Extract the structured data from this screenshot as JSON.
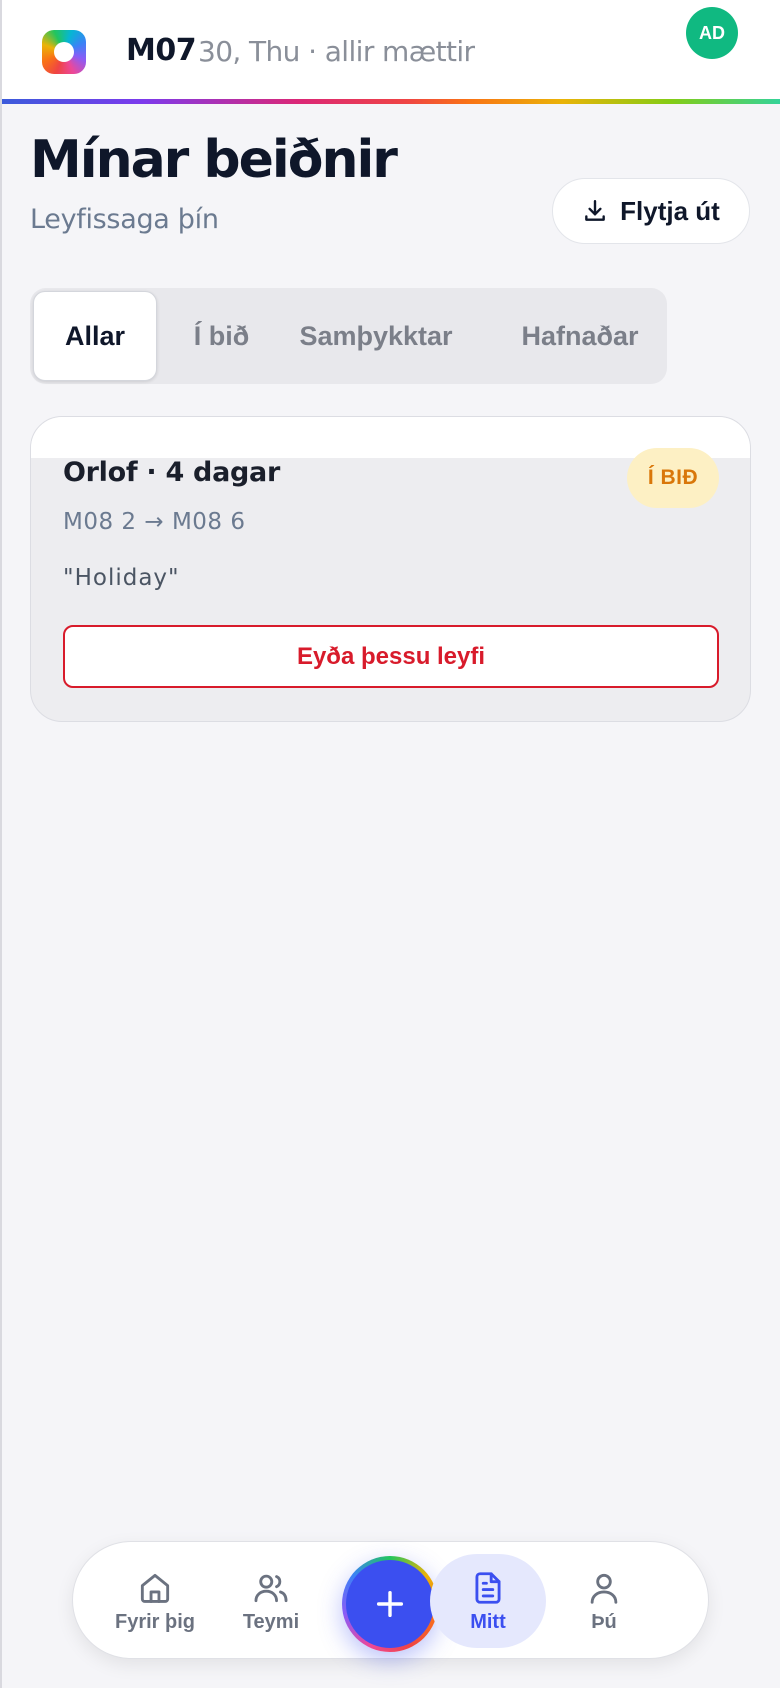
{
  "header": {
    "month": "M07",
    "info": "30, Thu · allir mættir",
    "avatar_initials": "AD"
  },
  "page": {
    "title": "Mínar beiðnir",
    "subtitle": "Leyfissaga þín",
    "export_label": "Flytja út"
  },
  "tabs": [
    {
      "label": "Allar",
      "active": true
    },
    {
      "label": "Í bið",
      "active": false
    },
    {
      "label": "Samþykktar",
      "active": false
    },
    {
      "label": "Hafnaðar",
      "active": false
    }
  ],
  "requests": [
    {
      "title": "Orlof · 4 dagar",
      "status": "Í BIÐ",
      "date_from": "M08 2",
      "date_to": "M08 6",
      "date_range": "M08 2 → M08 6",
      "reason": "\"Holiday\"",
      "delete_label": "Eyða þessu leyfi"
    }
  ],
  "bottom_nav": {
    "items": [
      {
        "label": "Fyrir þig",
        "icon": "home-icon"
      },
      {
        "label": "Teymi",
        "icon": "users-icon"
      },
      {
        "label": "Mitt",
        "icon": "document-icon",
        "active": true
      },
      {
        "label": "Þú",
        "icon": "user-icon"
      }
    ],
    "fab_icon": "plus-icon"
  },
  "colors": {
    "accent": "#3b4ff0",
    "avatar_bg": "#10b981",
    "danger": "#d81b2b",
    "pending_badge_bg": "#fdf0c4",
    "pending_badge_text": "#d9770a"
  }
}
